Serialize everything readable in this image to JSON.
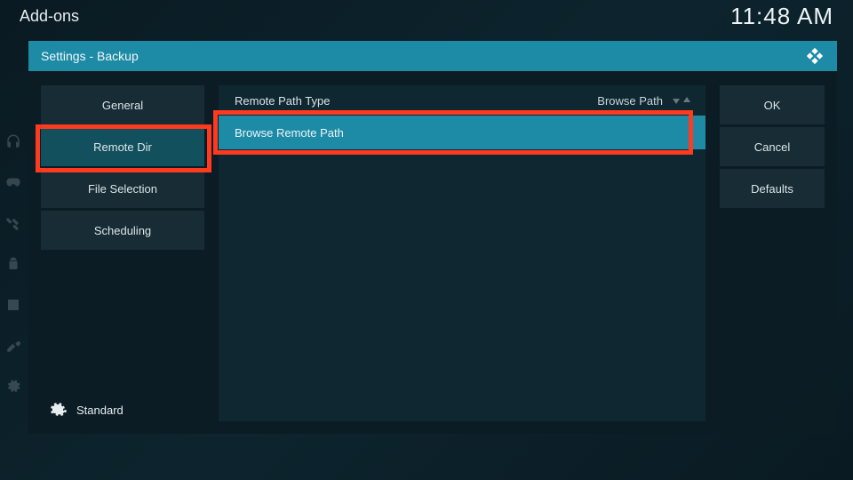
{
  "topbar": {
    "title": "Add-ons",
    "clock": "11:48 AM"
  },
  "dialog": {
    "title": "Settings - Backup",
    "categories": [
      {
        "label": "General"
      },
      {
        "label": "Remote Dir"
      },
      {
        "label": "File Selection"
      },
      {
        "label": "Scheduling"
      }
    ],
    "level": "Standard",
    "rows": {
      "remote_path_type": {
        "label": "Remote Path Type",
        "value": "Browse Path"
      },
      "browse_remote_path": {
        "label": "Browse Remote Path"
      }
    },
    "buttons": {
      "ok": "OK",
      "cancel": "Cancel",
      "defaults": "Defaults"
    }
  }
}
